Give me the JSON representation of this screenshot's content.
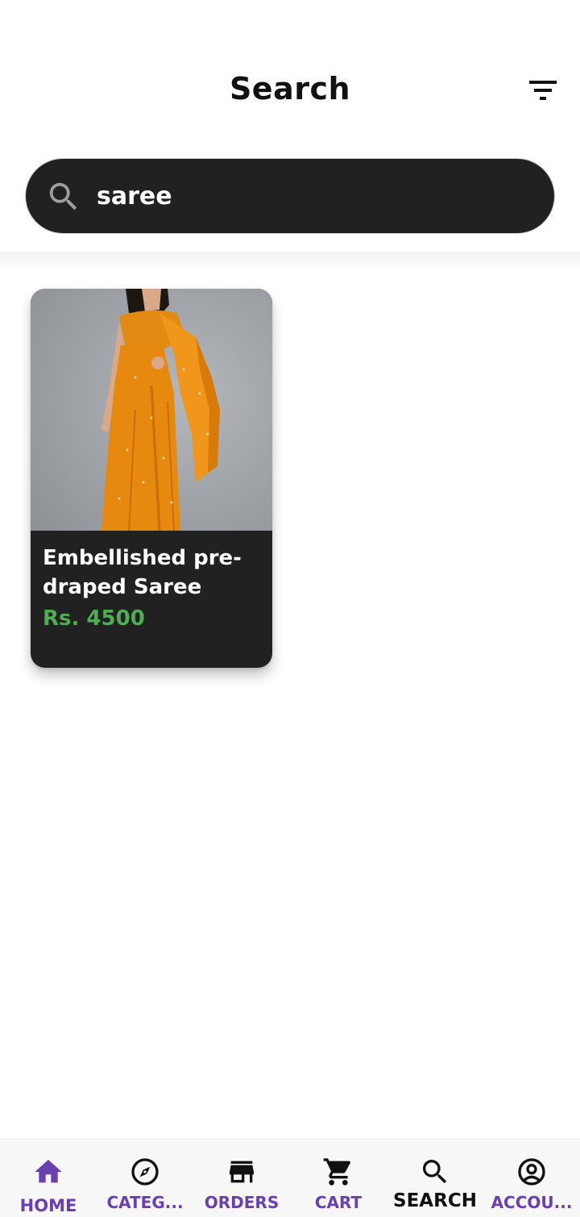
{
  "header": {
    "title": "Search",
    "filter_icon": "filter-list-icon"
  },
  "search": {
    "icon": "search-icon",
    "value": "saree"
  },
  "results": [
    {
      "image": "orange-saree-product-photo",
      "title": "Embellished pre-draped Saree",
      "price": "Rs. 4500"
    }
  ],
  "bottom_nav": {
    "items": [
      {
        "label": "HOME",
        "icon": "home-icon"
      },
      {
        "label": "CATEG...",
        "icon": "compass-icon"
      },
      {
        "label": "ORDERS",
        "icon": "store-icon"
      },
      {
        "label": "CART",
        "icon": "cart-icon"
      },
      {
        "label": "SEARCH",
        "icon": "search-icon"
      },
      {
        "label": "ACCOU...",
        "icon": "account-circle-icon"
      }
    ],
    "active": "SEARCH"
  },
  "colors": {
    "accent": "#6a3fb0",
    "price": "#4caf50",
    "dark": "#212121"
  }
}
